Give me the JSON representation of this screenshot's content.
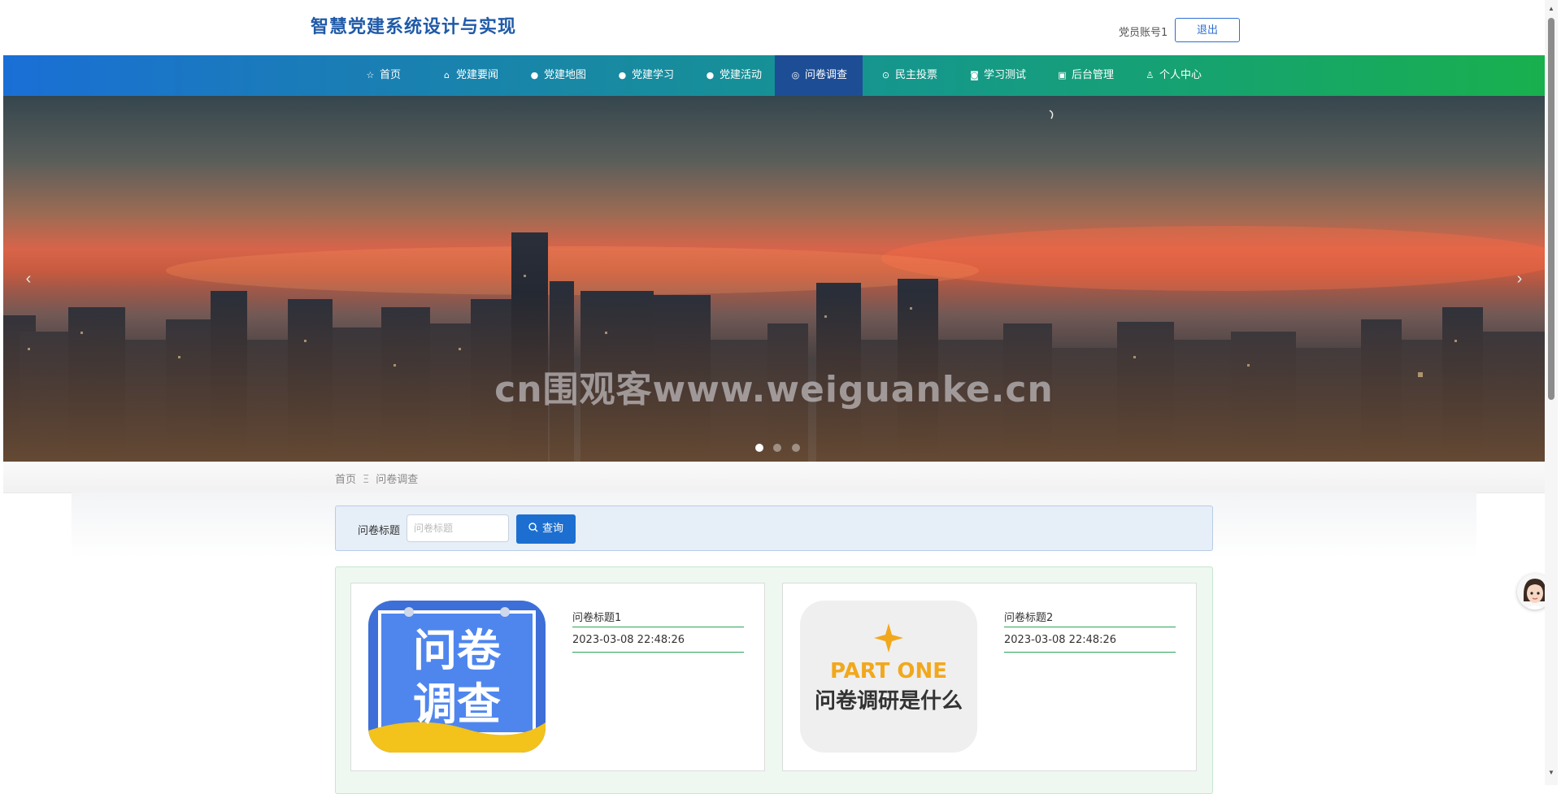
{
  "header": {
    "title": "智慧党建系统设计与实现",
    "account": "党员账号1",
    "logout_label": "退出"
  },
  "nav": {
    "items": [
      {
        "label": "首页",
        "icon": "star-icon"
      },
      {
        "label": "党建要闻",
        "icon": "bag-icon"
      },
      {
        "label": "党建地图",
        "icon": "info-circle-icon"
      },
      {
        "label": "党建学习",
        "icon": "question-circle-icon"
      },
      {
        "label": "党建活动",
        "icon": "info-circle-icon"
      },
      {
        "label": "问卷调查",
        "icon": "circle-dot-icon",
        "active": true
      },
      {
        "label": "民主投票",
        "icon": "check-circle-icon"
      },
      {
        "label": "学习测试",
        "icon": "camera-icon"
      },
      {
        "label": "后台管理",
        "icon": "building-icon"
      },
      {
        "label": "个人中心",
        "icon": "user-icon"
      }
    ]
  },
  "banner": {
    "watermark": "cn围观客www.weiguanke.cn",
    "prev_icon": "chevron-left-icon",
    "next_icon": "chevron-right-icon",
    "slide_count": 3,
    "active_slide": 1
  },
  "breadcrumb": {
    "home": "首页",
    "separator": "Ξ",
    "current": "问卷调查"
  },
  "search": {
    "label": "问卷标题",
    "placeholder": "问卷标题",
    "value": "",
    "button_label": "查询",
    "button_icon": "search-icon"
  },
  "surveys": [
    {
      "title": "问卷标题1",
      "date": "2023-03-08 22:48:26",
      "image_text": [
        "问卷",
        "调查"
      ]
    },
    {
      "title": "问卷标题2",
      "date": "2023-03-08 22:48:26",
      "image_text": [
        "PART ONE",
        "问卷调研是什么"
      ]
    }
  ],
  "colors": {
    "nav_start": "#1a6fd6",
    "nav_end": "#18b04e",
    "nav_active": "#1d4e95",
    "title": "#1f5aa8",
    "button": "#1c6fd0",
    "card_line": "#2aa55a"
  }
}
